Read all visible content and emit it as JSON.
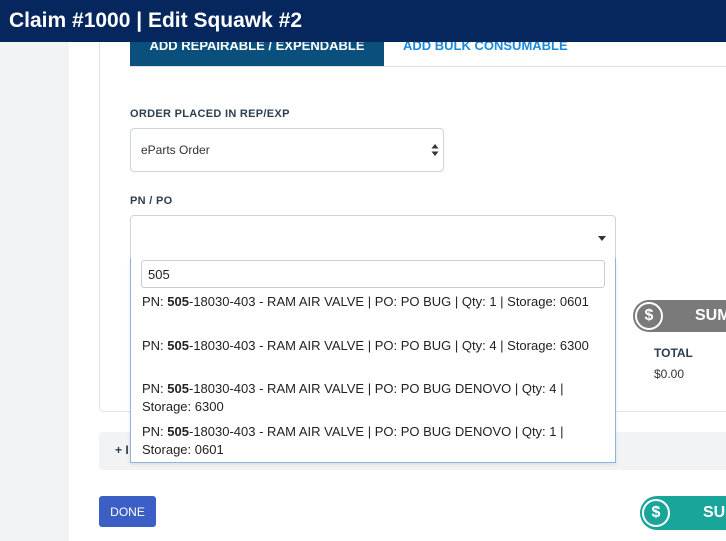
{
  "header": {
    "title": "Claim #1000 | Edit Squawk #2"
  },
  "colors": {
    "header_bg": "#06275e",
    "tab_active_bg": "#0b4f7d",
    "tab_link": "#1c8ad8",
    "done_button": "#3b5fc4",
    "summary_grey": "#7a7a7a",
    "summary_teal": "#1aa59a"
  },
  "tabs": [
    {
      "label": "ADD REPAIRABLE / EXPENDABLE",
      "active": true
    },
    {
      "label": "ADD BULK CONSUMABLE",
      "active": false
    }
  ],
  "order_field": {
    "label": "ORDER PLACED IN REP/EXP",
    "value": "eParts Order"
  },
  "pn_po_field": {
    "label": "PN / PO",
    "search_value": "505",
    "options": [
      {
        "match": "505",
        "rest": "-18030-403 - RAM AIR VALVE | PO: PO BUG | Qty: 1 | Storage: 0601"
      },
      {
        "match": "505",
        "rest": "-18030-403 - RAM AIR VALVE | PO: PO BUG | Qty: 4 | Storage: 6300"
      },
      {
        "match": "505",
        "rest": "-18030-403 - RAM AIR VALVE | PO: PO BUG DENOVO | Qty: 4 | Storage: 6300"
      },
      {
        "match": "505",
        "rest": "-18030-403 - RAM AIR VALVE | PO: PO BUG DENOVO | Qty: 1 | Storage: 0601"
      }
    ],
    "option_prefix": "PN: "
  },
  "summary": {
    "label": "SUM",
    "dollar_icon": "$",
    "total_label": "TOTAL",
    "total_value": "$0.00"
  },
  "add_bar": {
    "label": "+ I"
  },
  "footer": {
    "done_label": "DONE",
    "summary_label": "SU"
  }
}
